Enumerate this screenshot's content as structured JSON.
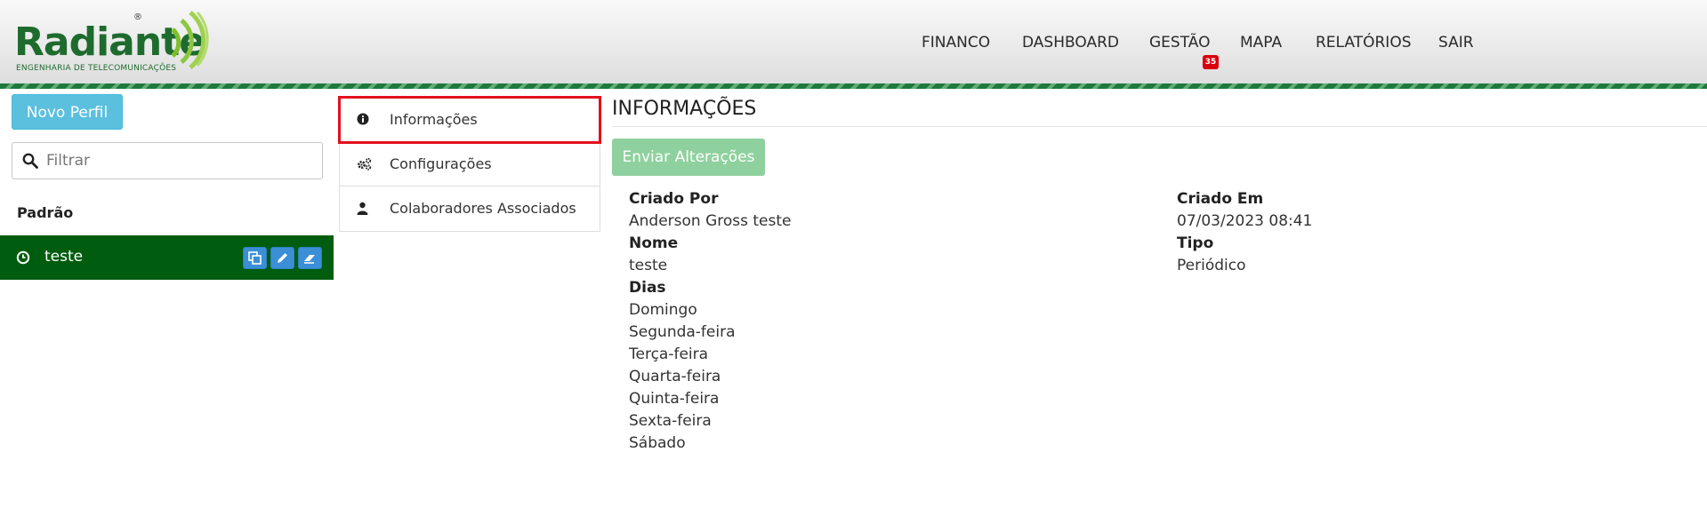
{
  "brand": {
    "name": "Radiante",
    "tagline": "ENGENHARIA DE TELECOMUNICAÇÕES",
    "registered": "®",
    "color": "#1e6b2e"
  },
  "nav": {
    "items": [
      {
        "label": "FINANCO"
      },
      {
        "label": "DASHBOARD"
      },
      {
        "label": "GESTÃO",
        "badge": "35"
      },
      {
        "label": "MAPA"
      },
      {
        "label": "RELATÓRIOS"
      },
      {
        "label": "SAIR"
      }
    ]
  },
  "sidebar": {
    "new_profile_label": "Novo Perfil",
    "filter_placeholder": "Filtrar",
    "section_label": "Padrão",
    "profiles": [
      {
        "name": "teste",
        "icon": "clock-icon",
        "actions": [
          "copy-icon",
          "pencil-icon",
          "eraser-icon"
        ]
      }
    ],
    "selected_color": "#005c0e"
  },
  "menu": {
    "items": [
      {
        "label": "Informações",
        "icon": "info-icon",
        "active": true
      },
      {
        "label": "Configurações",
        "icon": "gears-icon"
      },
      {
        "label": "Colaboradores Associados",
        "icon": "user-icon"
      }
    ]
  },
  "content": {
    "title": "INFORMAÇÕES",
    "submit_label": "Enviar Alterações",
    "left_fields": {
      "created_by_label": "Criado Por",
      "created_by_value": "Anderson Gross teste",
      "name_label": "Nome",
      "name_value": "teste",
      "days_label": "Dias",
      "days": [
        "Domingo",
        "Segunda-feira",
        "Terça-feira",
        "Quarta-feira",
        "Quinta-feira",
        "Sexta-feira",
        "Sábado"
      ]
    },
    "right_fields": {
      "created_at_label": "Criado Em",
      "created_at_value": "07/03/2023 08:41",
      "type_label": "Tipo",
      "type_value": "Periódico"
    }
  }
}
